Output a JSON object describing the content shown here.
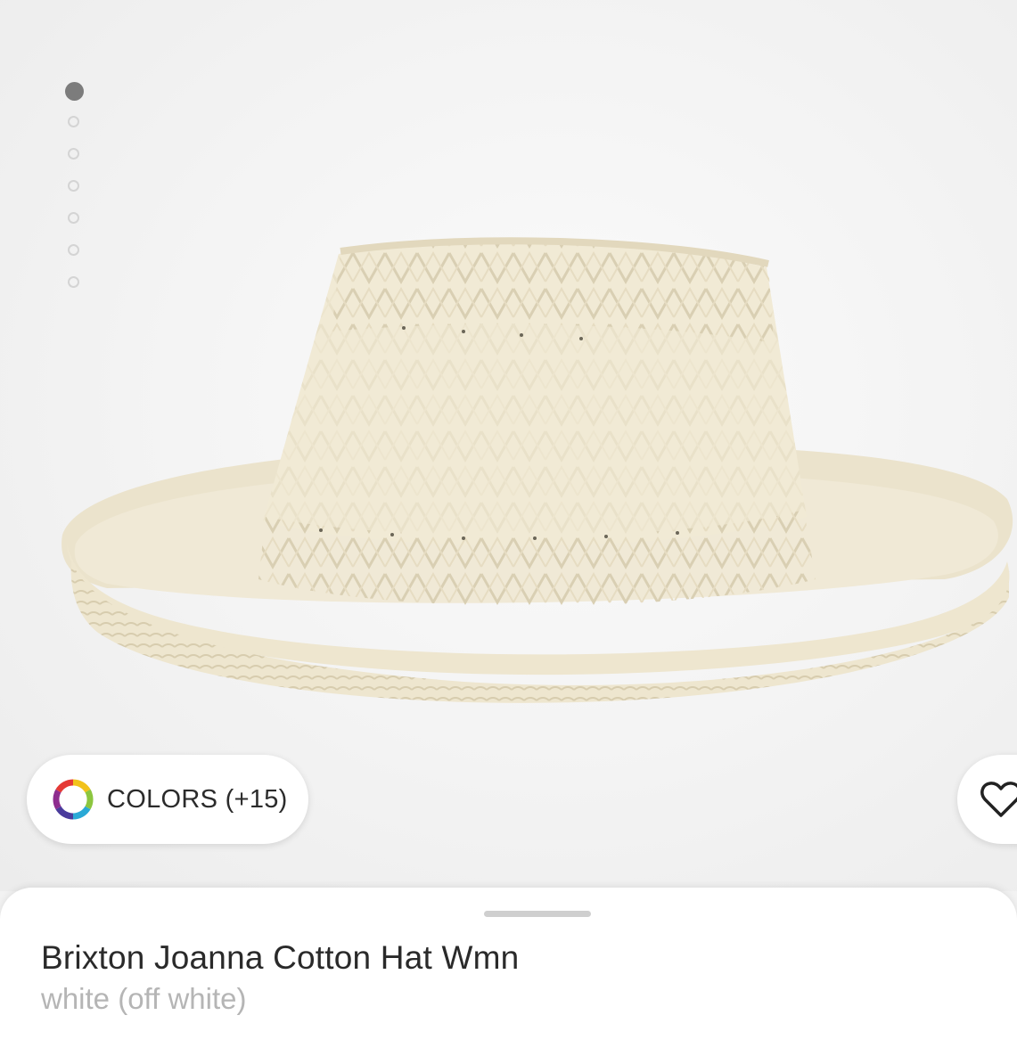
{
  "gallery": {
    "image_alt": "Brixton Joanna Cotton Hat Wmn",
    "slide_count": 7,
    "active_slide": 1
  },
  "colors_button": {
    "label": "COLORS (+15)",
    "icon": "color-wheel-icon"
  },
  "wishlist_button": {
    "icon": "heart-icon"
  },
  "product": {
    "title": "Brixton Joanna Cotton Hat Wmn",
    "color": "white (off white)"
  },
  "colors": {
    "hat": "#efe8d3",
    "indicator_active": "#7c7c7c",
    "indicator_inactive": "#d4d4d4"
  }
}
